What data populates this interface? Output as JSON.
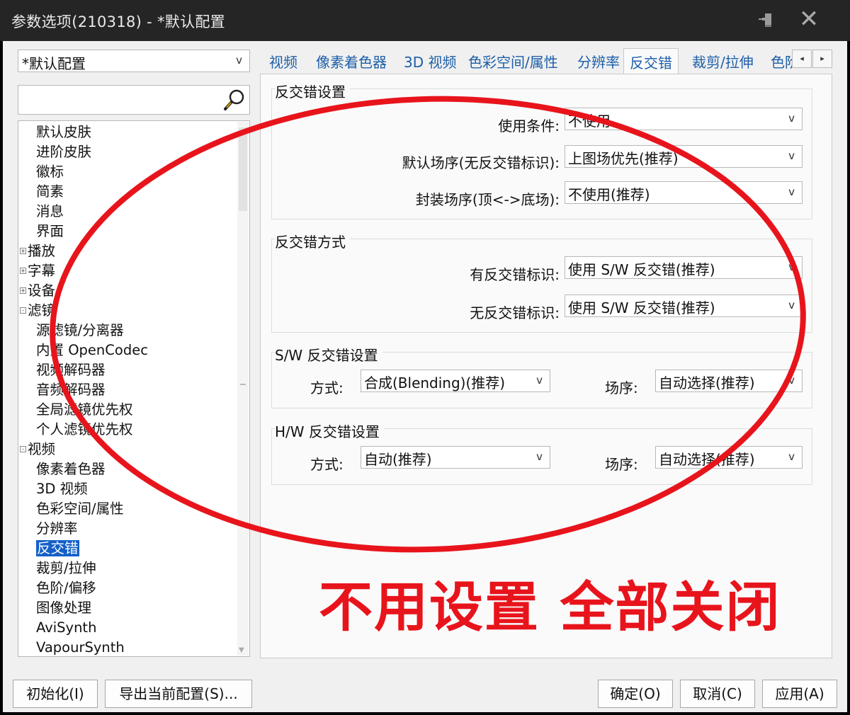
{
  "window": {
    "title": "参数选项(210318) - *默认配置",
    "pin_icon": "pin-icon",
    "close_icon": "close-icon"
  },
  "profile": {
    "value": "*默认配置",
    "arrow": "v"
  },
  "search": {
    "value": "",
    "icon": "search-icon"
  },
  "tree": [
    {
      "label": "默认皮肤"
    },
    {
      "label": "进阶皮肤"
    },
    {
      "label": "徽标"
    },
    {
      "label": "简素"
    },
    {
      "label": "消息"
    },
    {
      "label": "界面"
    },
    {
      "label": "播放",
      "exp": "+"
    },
    {
      "label": "字幕",
      "exp": "+"
    },
    {
      "label": "设备",
      "exp": "+"
    },
    {
      "label": "滤镜",
      "exp": "-"
    },
    {
      "label": "源滤镜/分离器"
    },
    {
      "label": "内置 OpenCodec"
    },
    {
      "label": "视频解码器"
    },
    {
      "label": "音频解码器"
    },
    {
      "label": "全局滤镜优先权"
    },
    {
      "label": "个人滤镜优先权"
    },
    {
      "label": "视频",
      "exp": "-"
    },
    {
      "label": "像素着色器"
    },
    {
      "label": "3D 视频"
    },
    {
      "label": "色彩空间/属性"
    },
    {
      "label": "分辨率"
    },
    {
      "label": "反交错",
      "selected": true
    },
    {
      "label": "裁剪/拉伸"
    },
    {
      "label": "色阶/偏移"
    },
    {
      "label": "图像处理"
    },
    {
      "label": "AviSynth"
    },
    {
      "label": "VapourSynth"
    }
  ],
  "tabs": [
    "视频",
    "像素着色器",
    "3D 视频",
    "色彩空间/属性",
    "分辨率",
    "反交错",
    "裁剪/拉伸",
    "色阶/偏移"
  ],
  "tab_active": "反交错",
  "tab_scroll": {
    "left": "◂",
    "right": "▸"
  },
  "deint_settings": {
    "title": "反交错设置",
    "use_condition_label": "使用条件:",
    "use_condition_value": "不使用",
    "default_field_label": "默认场序(无反交错标识):",
    "default_field_value": "上图场优先(推荐)",
    "encode_field_label": "封装场序(顶<->底场):",
    "encode_field_value": "不使用(推荐)"
  },
  "deint_method": {
    "title": "反交错方式",
    "with_flag_label": "有反交错标识:",
    "with_flag_value": "使用 S/W 反交错(推荐)",
    "without_flag_label": "无反交错标识:",
    "without_flag_value": "使用 S/W 反交错(推荐)"
  },
  "sw_settings": {
    "title": "S/W 反交错设置",
    "method_label": "方式:",
    "method_value": "合成(Blending)(推荐)",
    "field_label": "场序:",
    "field_value": "自动选择(推荐)"
  },
  "hw_settings": {
    "title": "H/W 反交错设置",
    "method_label": "方式:",
    "method_value": "自动(推荐)",
    "field_label": "场序:",
    "field_value": "自动选择(推荐)"
  },
  "combo_arrow": "v",
  "buttons": {
    "init": "初始化(I)",
    "export": "导出当前配置(S)...",
    "ok": "确定(O)",
    "cancel": "取消(C)",
    "apply": "应用(A)"
  },
  "annotation": {
    "text": "不用设置 全部关闭",
    "color": "#e8141c"
  }
}
